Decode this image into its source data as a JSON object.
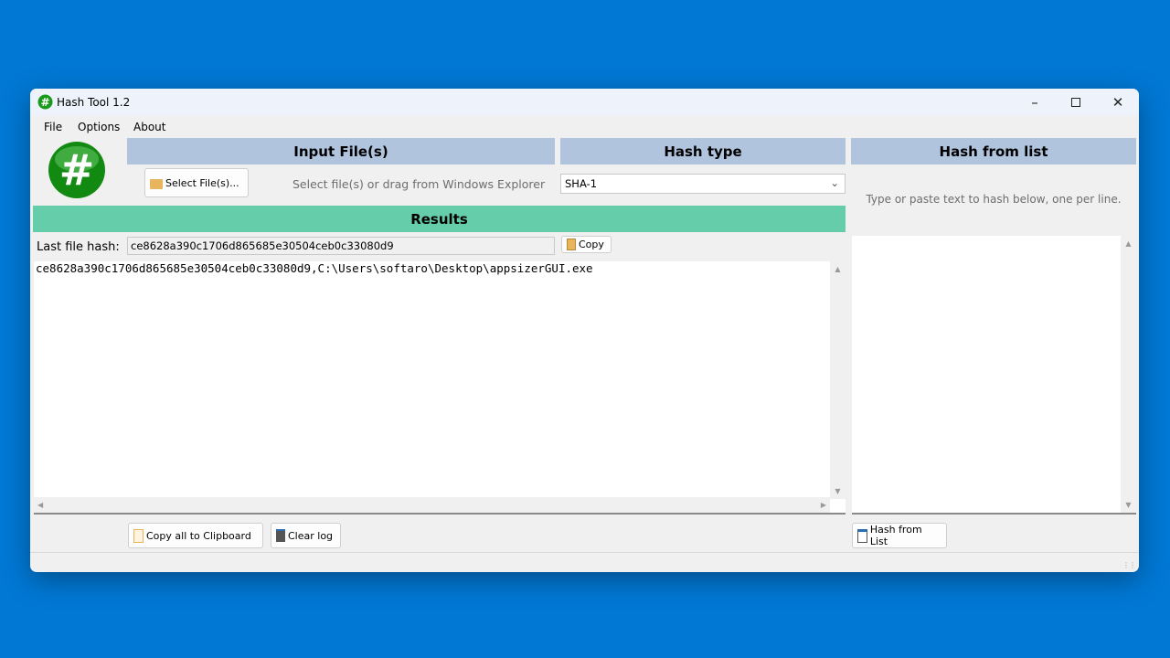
{
  "window": {
    "title": "Hash Tool 1.2",
    "minimize_icon": "minimize-icon",
    "maximize_icon": "maximize-icon",
    "close_icon": "close-icon"
  },
  "menu": {
    "file": "File",
    "options": "Options",
    "about": "About"
  },
  "input": {
    "header": "Input File(s)",
    "select_button": "Select File(s)...",
    "hint": "Select file(s) or drag from Windows Explorer"
  },
  "hash_type": {
    "header": "Hash type",
    "selected": "SHA-1"
  },
  "results": {
    "header": "Results",
    "last_hash_label": "Last file hash:",
    "last_hash_value": "ce8628a390c1706d865685e30504ceb0c33080d9",
    "copy_button": "Copy",
    "log_lines": [
      "ce8628a390c1706d865685e30504ceb0c33080d9,C:\\Users\\softaro\\Desktop\\appsizerGUI.exe"
    ],
    "copy_all_button": "Copy all to Clipboard",
    "clear_log_button": "Clear log"
  },
  "hash_list": {
    "header": "Hash from list",
    "hint": "Type or paste text to hash below, one per line.",
    "button": "Hash from List"
  },
  "colors": {
    "header_bg": "#b0c4de",
    "results_bg": "#66cdaa",
    "logo_green": "#1a9a1a"
  }
}
